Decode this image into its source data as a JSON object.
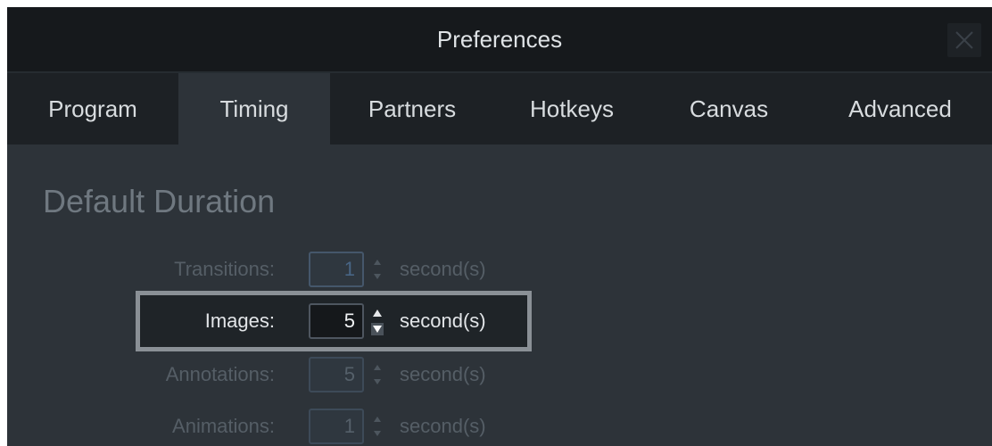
{
  "window": {
    "title": "Preferences",
    "close_icon": "close-icon"
  },
  "tabs": [
    {
      "label": "Program",
      "active": false
    },
    {
      "label": "Timing",
      "active": true
    },
    {
      "label": "Partners",
      "active": false
    },
    {
      "label": "Hotkeys",
      "active": false
    },
    {
      "label": "Canvas",
      "active": false
    },
    {
      "label": "Advanced",
      "active": false
    }
  ],
  "section": {
    "title": "Default Duration"
  },
  "durations": [
    {
      "label": "Transitions:",
      "value": "1",
      "unit": "second(s)",
      "enabled": false
    },
    {
      "label": "Images:",
      "value": "5",
      "unit": "second(s)",
      "enabled": true
    },
    {
      "label": "Annotations:",
      "value": "5",
      "unit": "second(s)",
      "enabled": false
    },
    {
      "label": "Animations:",
      "value": "1",
      "unit": "second(s)",
      "enabled": false
    }
  ],
  "colors": {
    "titlebar_bg": "#16191c",
    "tabbar_bg": "#1d2125",
    "panel_bg": "#2d3339",
    "highlight_border": "#8a9096"
  }
}
